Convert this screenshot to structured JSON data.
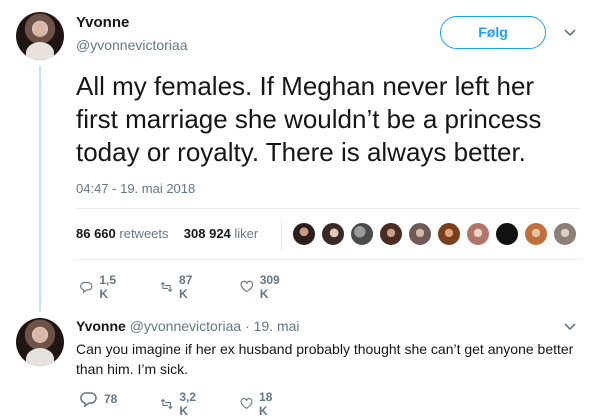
{
  "tweet": {
    "author_name": "Yvonne",
    "author_handle": "@yvonnevictoriaa",
    "follow_label": "Følg",
    "text": "All my females. If Meghan never left her first marriage she wouldn’t be a princess today or royalty. There is always better.",
    "timestamp": "04:47 - 19. mai 2018",
    "stats": {
      "retweets_count": "86 660",
      "retweets_label": "retweets",
      "likes_count": "308 924",
      "likes_label": "liker"
    },
    "actions": {
      "replies": "1,5 K",
      "retweets": "87 K",
      "likes": "309 K"
    }
  },
  "reply": {
    "author_name": "Yvonne",
    "author_handle": "@yvonnevictoriaa",
    "date": "· 19. mai",
    "text": "Can you imagine if her ex husband probably thought she can’t get anyone better than him. I’m sick.",
    "actions": {
      "replies": "78",
      "retweets": "3,2 K",
      "likes": "18 K"
    }
  },
  "colors": {
    "accent": "#1da1f2",
    "secondary_text": "#657786",
    "thread_line": "#c4e3f5"
  },
  "icons": [
    "chevron-down-icon",
    "reply-icon",
    "retweet-icon",
    "heart-icon"
  ]
}
